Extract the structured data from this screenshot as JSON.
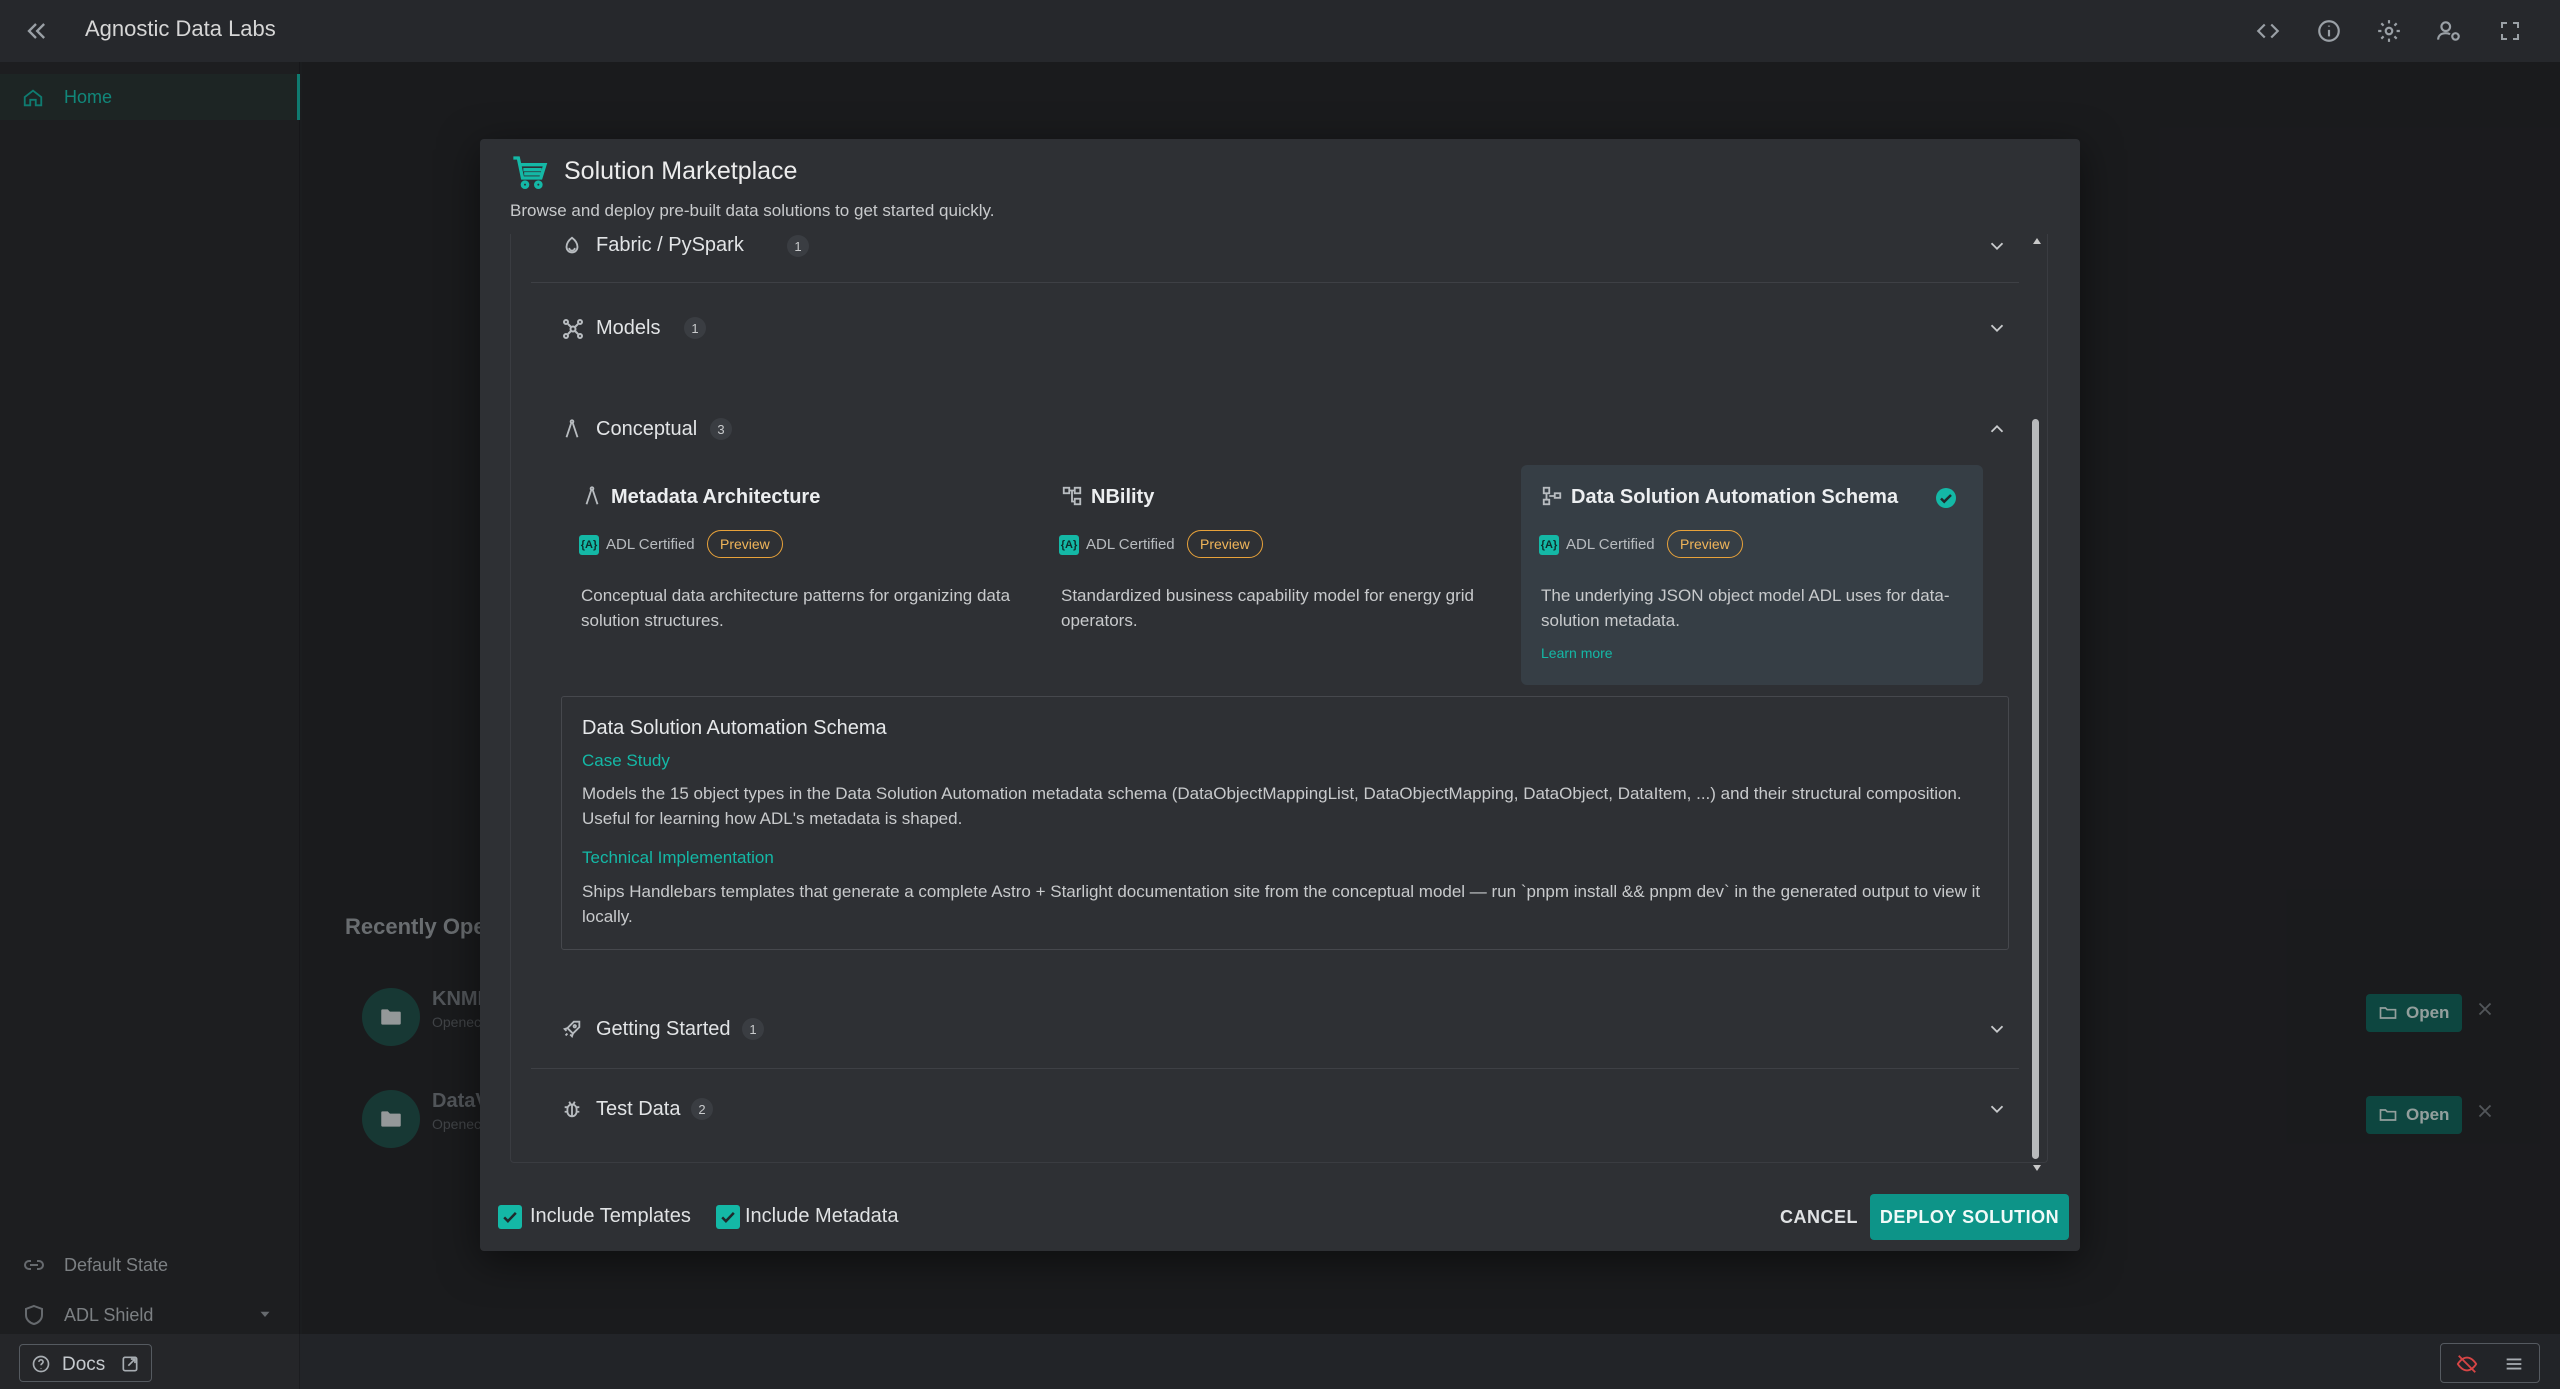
{
  "app": {
    "title": "Agnostic Data Labs"
  },
  "topbar": {
    "icons": [
      "code-icon",
      "info-icon",
      "gear-icon",
      "user-settings-icon",
      "fullscreen-icon"
    ]
  },
  "sidebar": {
    "home_label": "Home",
    "default_state_label": "Default State",
    "shield_label": "ADL Shield",
    "docs_label": "Docs"
  },
  "recent": {
    "title": "Recently Ope",
    "items": [
      {
        "name": "KNMI",
        "sub": "Openec",
        "open_label": "Open"
      },
      {
        "name": "DataV",
        "sub": "Openec",
        "open_label": "Open"
      }
    ]
  },
  "modal": {
    "title": "Solution Marketplace",
    "subtitle": "Browse and deploy pre-built data solutions to get started quickly.",
    "categories": [
      {
        "label": "Fabric / PySpark",
        "count": "1",
        "icon": "fabric-icon",
        "expanded": false
      },
      {
        "label": "Models",
        "count": "1",
        "icon": "models-icon",
        "expanded": false
      },
      {
        "label": "Conceptual",
        "count": "3",
        "icon": "compass-icon",
        "expanded": true
      },
      {
        "label": "Getting Started",
        "count": "1",
        "icon": "rocket-icon",
        "expanded": false
      },
      {
        "label": "Test Data",
        "count": "2",
        "icon": "bug-icon",
        "expanded": false
      }
    ],
    "cards": [
      {
        "title": "Metadata Architecture",
        "certified": "ADL Certified",
        "badge": "Preview",
        "description": "Conceptual data architecture patterns for organizing data solution structures.",
        "icon": "compass-icon",
        "selected": false
      },
      {
        "title": "NBility",
        "certified": "ADL Certified",
        "badge": "Preview",
        "description": "Standardized business capability model for energy grid operators.",
        "icon": "hierarchy-icon",
        "selected": false
      },
      {
        "title": "Data Solution Automation Schema",
        "certified": "ADL Certified",
        "badge": "Preview",
        "description": "The underlying JSON object model ADL uses for data-solution metadata.",
        "learn_more": "Learn more",
        "icon": "schema-icon",
        "selected": true
      }
    ],
    "detail": {
      "title": "Data Solution Automation Schema",
      "case_study_label": "Case Study",
      "case_study_text": "Models the 15 object types in the Data Solution Automation metadata schema (DataObjectMappingList, DataObjectMapping, DataObject, DataItem, ...) and their structural composition. Useful for learning how ADL's metadata is shaped.",
      "tech_label": "Technical Implementation",
      "tech_text": "Ships Handlebars templates that generate a complete Astro + Starlight documentation site from the conceptual model — run `pnpm install && pnpm dev` in the generated output to view it locally."
    },
    "footer": {
      "include_templates": "Include Templates",
      "include_metadata": "Include Metadata",
      "cancel": "CANCEL",
      "deploy": "DEPLOY SOLUTION"
    }
  },
  "colors": {
    "accent": "#14b8a6",
    "preview": "#e8a23a",
    "background": "#222428",
    "modal": "#2e3034"
  }
}
